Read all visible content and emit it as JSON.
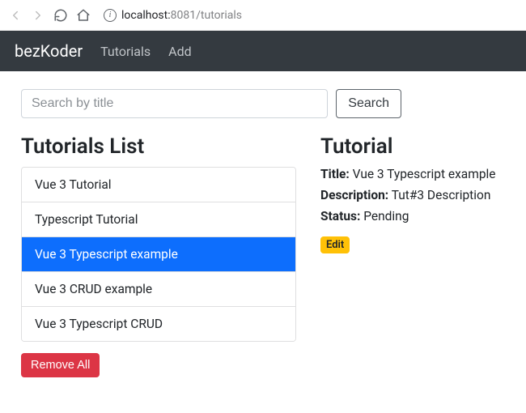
{
  "browser": {
    "url_host": "localhost:",
    "url_port_path": "8081/tutorials"
  },
  "nav": {
    "brand": "bezKoder",
    "links": [
      "Tutorials",
      "Add"
    ]
  },
  "search": {
    "placeholder": "Search by title",
    "button_label": "Search"
  },
  "list": {
    "heading": "Tutorials List",
    "items": [
      "Vue 3 Tutorial",
      "Typescript Tutorial",
      "Vue 3 Typescript example",
      "Vue 3 CRUD example",
      "Vue 3 Typescript CRUD"
    ],
    "active_index": 2,
    "remove_all_label": "Remove All"
  },
  "detail": {
    "heading": "Tutorial",
    "title_label": "Title:",
    "title_value": "Vue 3 Typescript example",
    "description_label": "Description:",
    "description_value": "Tut#3 Description",
    "status_label": "Status:",
    "status_value": "Pending",
    "edit_label": "Edit"
  }
}
